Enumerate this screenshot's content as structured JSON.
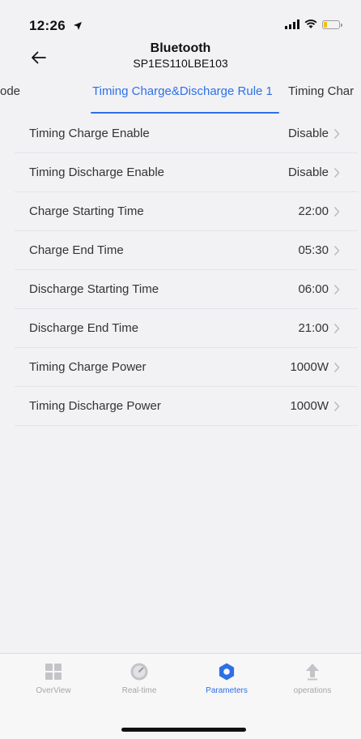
{
  "status": {
    "time": "12:26"
  },
  "header": {
    "title": "Bluetooth",
    "subtitle": "SP1ES110LBE103"
  },
  "tabs": [
    {
      "label": "ode"
    },
    {
      "label": "Timing Charge&Discharge Rule 1",
      "active": true
    },
    {
      "label": "Timing Char"
    }
  ],
  "settings": [
    {
      "label": "Timing Charge Enable",
      "value": "Disable"
    },
    {
      "label": "Timing Discharge Enable",
      "value": "Disable"
    },
    {
      "label": "Charge Starting Time",
      "value": "22:00"
    },
    {
      "label": "Charge End Time",
      "value": "05:30"
    },
    {
      "label": "Discharge Starting Time",
      "value": "06:00"
    },
    {
      "label": "Discharge End Time",
      "value": "21:00"
    },
    {
      "label": "Timing Charge Power",
      "value": "1000W"
    },
    {
      "label": "Timing Discharge Power",
      "value": "1000W"
    }
  ],
  "tabbar": [
    {
      "label": "OverView",
      "icon": "grid-icon"
    },
    {
      "label": "Real-time",
      "icon": "gauge-icon"
    },
    {
      "label": "Parameters",
      "icon": "gear-icon",
      "active": true
    },
    {
      "label": "operations",
      "icon": "upload-arrow-icon"
    }
  ],
  "colors": {
    "accent": "#2f6fe6",
    "inactive": "#a6a6a6",
    "background": "#f2f2f5"
  }
}
